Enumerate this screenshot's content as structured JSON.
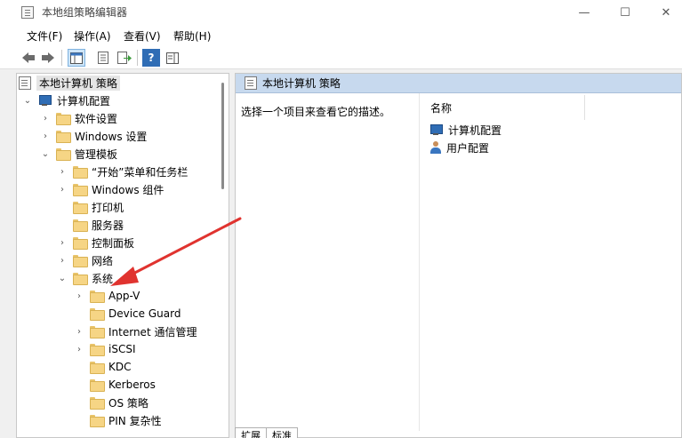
{
  "window": {
    "title": "本地组策略编辑器",
    "minimize_glyph": "—",
    "maximize_glyph": "☐",
    "close_glyph": "✕"
  },
  "menu": {
    "file": "文件(F)",
    "action": "操作(A)",
    "view": "查看(V)",
    "help": "帮助(H)"
  },
  "tree": {
    "root": "本地计算机 策略",
    "computer_config": "计算机配置",
    "software_settings": "软件设置",
    "windows_settings": "Windows 设置",
    "admin_templates": "管理模板",
    "start_menu": "“开始”菜单和任务栏",
    "windows_components": "Windows 组件",
    "printers": "打印机",
    "server": "服务器",
    "control_panel": "控制面板",
    "network": "网络",
    "system": "系统",
    "app_v": "App-V",
    "device_guard": "Device Guard",
    "internet_comm": "Internet 通信管理",
    "iscsi": "iSCSI",
    "kdc": "KDC",
    "kerberos": "Kerberos",
    "os_policy": "OS 策略",
    "pin_complexity": "PIN 复杂性"
  },
  "right": {
    "header_title": "本地计算机 策略",
    "description": "选择一个项目来查看它的描述。",
    "column_name": "名称",
    "items": [
      "计算机配置",
      "用户配置"
    ]
  },
  "tabs": [
    "扩展",
    "标准"
  ],
  "colors": {
    "header_bg": "#c7d9ee",
    "folder": "#f6d585",
    "arrow": "#e0332f"
  }
}
